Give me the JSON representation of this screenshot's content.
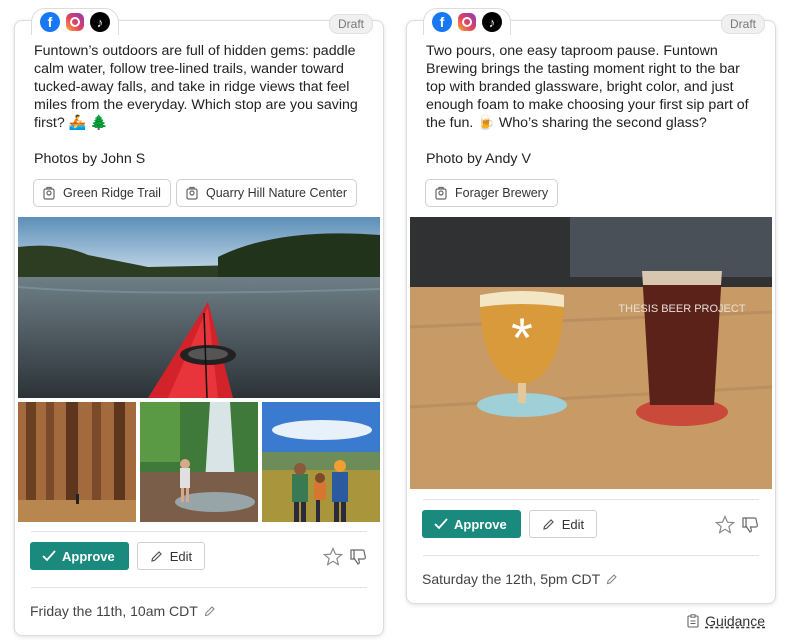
{
  "posts": [
    {
      "status": "Draft",
      "networks": [
        "facebook-icon",
        "instagram-icon",
        "tiktok-icon"
      ],
      "body": "Funtown’s outdoors are full of hidden gems: paddle calm water, follow tree-lined trails, wander toward tucked-away falls, and take in ridge views that feel miles from the everyday. Which stop are you saving first? 🚣 🌲",
      "credit": "Photos by John S",
      "tags": [
        "Green Ridge Trail",
        "Quarry Hill Nature Center"
      ],
      "approve_label": "Approve",
      "edit_label": "Edit",
      "schedule": "Friday the 11th, 10am CDT"
    },
    {
      "status": "Draft",
      "networks": [
        "facebook-icon",
        "instagram-icon",
        "tiktok-icon"
      ],
      "body": "Two pours, one easy taproom pause. Funtown Brewing brings the tasting moment right to the bar top with branded glassware, bright color, and just enough foam to make choosing your first sip part of the fun. 🍺  Who’s sharing the second glass?",
      "credit": "Photo by Andy V",
      "tags": [
        "Forager Brewery"
      ],
      "approve_label": "Approve",
      "edit_label": "Edit",
      "schedule": "Saturday the 12th, 5pm CDT",
      "glass_print_left": "*",
      "glass_print_right": "THESIS BEER PROJECT"
    }
  ],
  "guidance_label": "Guidance",
  "colors": {
    "approve": "#1a8a7e",
    "facebook": "#1877f2"
  }
}
